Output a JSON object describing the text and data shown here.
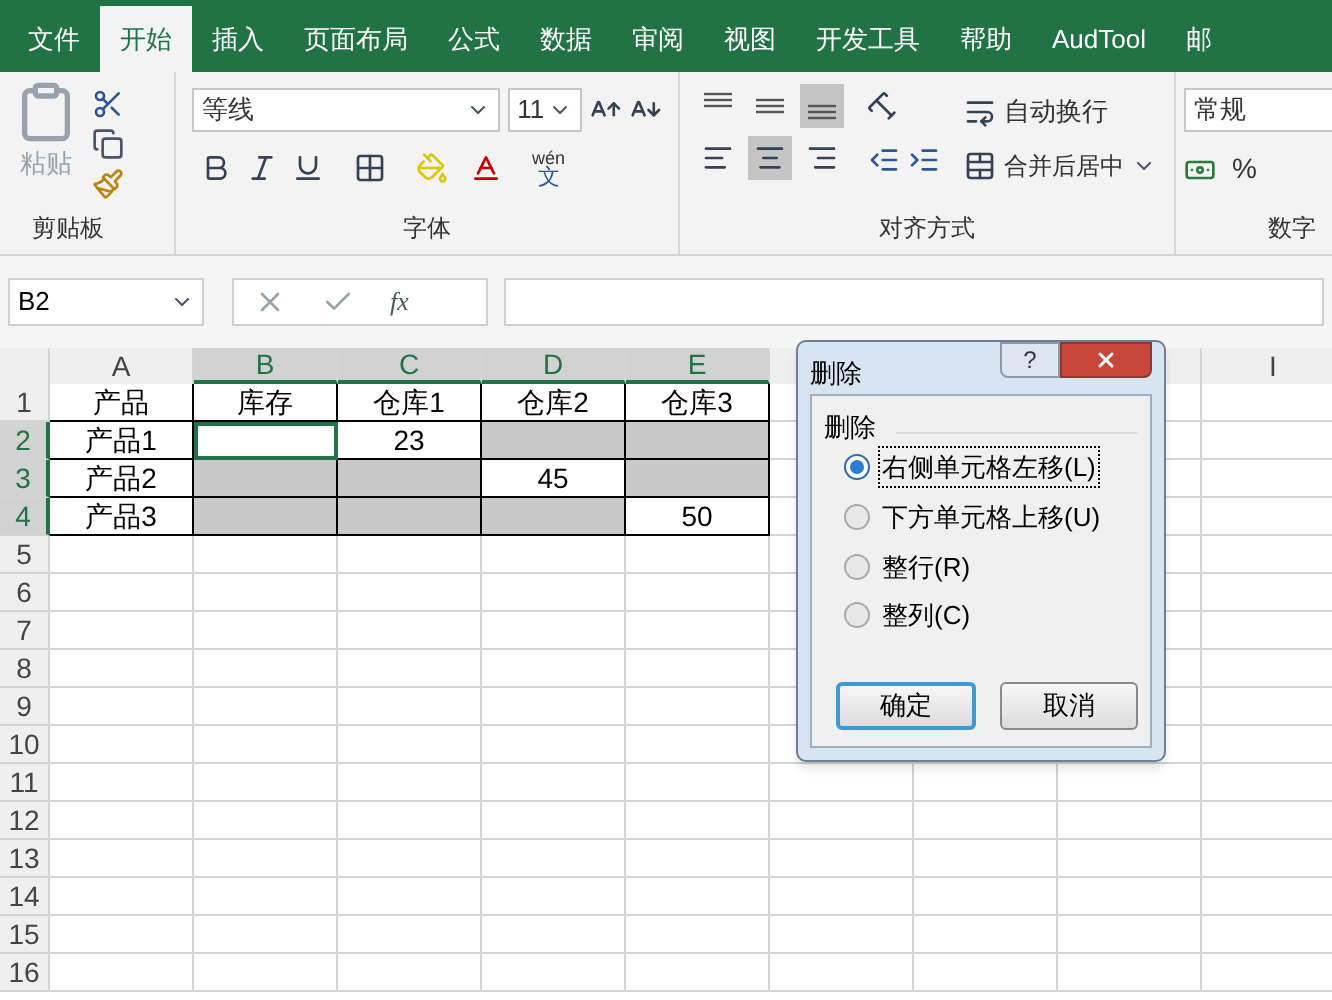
{
  "ribbon_tabs": [
    {
      "label": "文件",
      "selected": false
    },
    {
      "label": "开始",
      "selected": true
    },
    {
      "label": "插入",
      "selected": false
    },
    {
      "label": "页面布局",
      "selected": false
    },
    {
      "label": "公式",
      "selected": false
    },
    {
      "label": "数据",
      "selected": false
    },
    {
      "label": "审阅",
      "selected": false
    },
    {
      "label": "视图",
      "selected": false
    },
    {
      "label": "开发工具",
      "selected": false
    },
    {
      "label": "帮助",
      "selected": false
    },
    {
      "label": "AudTool",
      "selected": false
    },
    {
      "label": "邮",
      "selected": false
    }
  ],
  "clipboard": {
    "paste_label": "粘贴",
    "group_label": "剪贴板"
  },
  "font": {
    "font_name": "等线",
    "font_size": "11",
    "phonetic_top": "wén",
    "phonetic_bottom": "文",
    "group_label": "字体"
  },
  "alignment": {
    "vertical": [
      {
        "kind": "top",
        "selected": false
      },
      {
        "kind": "middle",
        "selected": false
      },
      {
        "kind": "bottom",
        "selected": true
      }
    ],
    "horizontal": [
      {
        "kind": "left",
        "selected": false
      },
      {
        "kind": "center",
        "selected": true
      },
      {
        "kind": "right",
        "selected": false
      }
    ],
    "wrap_text": "自动换行",
    "merge_center": "合并后居中",
    "group_label": "对齐方式"
  },
  "number": {
    "format": "常规",
    "percent": "%",
    "group_label": "数字"
  },
  "formula_bar": {
    "name_box": "B2",
    "fx": "fx"
  },
  "sheet": {
    "columns": [
      {
        "label": "A",
        "selected": false
      },
      {
        "label": "B",
        "selected": true
      },
      {
        "label": "C",
        "selected": true
      },
      {
        "label": "D",
        "selected": true
      },
      {
        "label": "E",
        "selected": true
      },
      {
        "label": "I",
        "selected": false
      }
    ],
    "rows": [
      {
        "number": "1",
        "selected": false,
        "cells": [
          {
            "text": "产品",
            "shaded": false,
            "selected": false
          },
          {
            "text": "库存",
            "shaded": false,
            "selected": false
          },
          {
            "text": "仓库1",
            "shaded": false,
            "selected": false
          },
          {
            "text": "仓库2",
            "shaded": false,
            "selected": false
          },
          {
            "text": "仓库3",
            "shaded": false,
            "selected": false
          }
        ]
      },
      {
        "number": "2",
        "selected": true,
        "cells": [
          {
            "text": "产品1",
            "shaded": false,
            "selected": false
          },
          {
            "text": "",
            "shaded": false,
            "selected": true
          },
          {
            "text": "23",
            "shaded": false,
            "selected": false
          },
          {
            "text": "",
            "shaded": true,
            "selected": false
          },
          {
            "text": "",
            "shaded": true,
            "selected": false
          }
        ]
      },
      {
        "number": "3",
        "selected": true,
        "cells": [
          {
            "text": "产品2",
            "shaded": false,
            "selected": false
          },
          {
            "text": "",
            "shaded": true,
            "selected": false
          },
          {
            "text": "",
            "shaded": true,
            "selected": false
          },
          {
            "text": "45",
            "shaded": false,
            "selected": false
          },
          {
            "text": "",
            "shaded": true,
            "selected": false
          }
        ]
      },
      {
        "number": "4",
        "selected": true,
        "cells": [
          {
            "text": "产品3",
            "shaded": false,
            "selected": false
          },
          {
            "text": "",
            "shaded": true,
            "selected": false
          },
          {
            "text": "",
            "shaded": true,
            "selected": false
          },
          {
            "text": "",
            "shaded": true,
            "selected": false
          },
          {
            "text": "50",
            "shaded": false,
            "selected": false
          }
        ]
      },
      {
        "number": "5",
        "selected": false
      },
      {
        "number": "6",
        "selected": false
      },
      {
        "number": "7",
        "selected": false
      },
      {
        "number": "8",
        "selected": false
      },
      {
        "number": "9",
        "selected": false
      },
      {
        "number": "10",
        "selected": false
      },
      {
        "number": "11",
        "selected": false
      },
      {
        "number": "12",
        "selected": false
      },
      {
        "number": "13",
        "selected": false
      },
      {
        "number": "14",
        "selected": false
      },
      {
        "number": "15",
        "selected": false
      },
      {
        "number": "16",
        "selected": false
      }
    ]
  },
  "dialog": {
    "title": "删除",
    "help": "?",
    "group_label": "删除",
    "options": [
      {
        "label": "右侧单元格左移(L)",
        "selected": true
      },
      {
        "label": "下方单元格上移(U)",
        "selected": false
      },
      {
        "label": "整行(R)",
        "selected": false
      },
      {
        "label": "整列(C)",
        "selected": false
      }
    ],
    "buttons": [
      {
        "label": "确定",
        "default": true
      },
      {
        "label": "取消",
        "default": false
      }
    ]
  }
}
